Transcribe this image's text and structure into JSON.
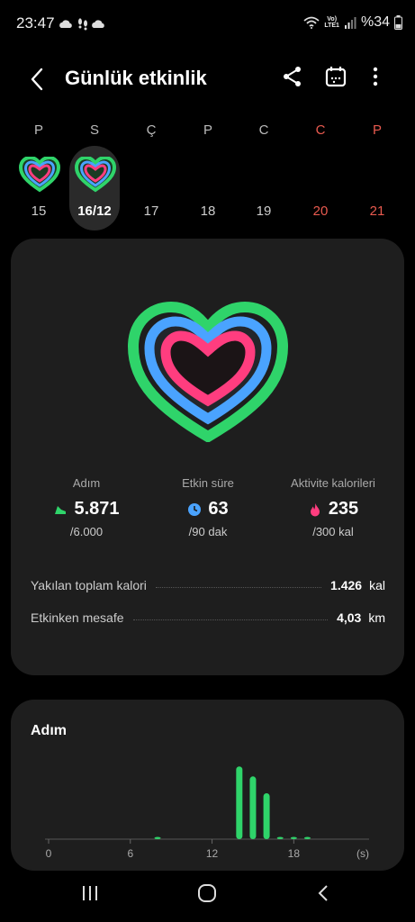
{
  "status_bar": {
    "time": "23:47",
    "left_icons": [
      "cloud-icon",
      "footsteps-icon",
      "cloud-icon"
    ],
    "right_icons": [
      "wifi-icon",
      "volte-icon",
      "signal-icon"
    ],
    "volte_text_1": "Vo)",
    "volte_text_2": "LTE1",
    "battery": "%34"
  },
  "app_bar": {
    "title": "Günlük etkinlik",
    "icons": [
      "back-icon",
      "share-icon",
      "calendar-icon",
      "more-icon"
    ]
  },
  "week": {
    "days": [
      {
        "letter": "P",
        "num": "15",
        "selected": false,
        "weekend": false,
        "has_ring": true
      },
      {
        "letter": "S",
        "num": "16/12",
        "selected": true,
        "weekend": false,
        "has_ring": true
      },
      {
        "letter": "Ç",
        "num": "17",
        "selected": false,
        "weekend": false,
        "has_ring": false
      },
      {
        "letter": "P",
        "num": "18",
        "selected": false,
        "weekend": false,
        "has_ring": false
      },
      {
        "letter": "C",
        "num": "19",
        "selected": false,
        "weekend": false,
        "has_ring": false
      },
      {
        "letter": "C",
        "num": "20",
        "selected": false,
        "weekend": true,
        "has_ring": false
      },
      {
        "letter": "P",
        "num": "21",
        "selected": false,
        "weekend": true,
        "has_ring": false
      }
    ],
    "weekend_color": "#e85a4f"
  },
  "summary": {
    "stats": [
      {
        "label": "Adım",
        "value": "5.871",
        "goal": "/6.000",
        "icon": "shoe-icon",
        "color": "#2fd46a",
        "progress": 0.98
      },
      {
        "label": "Etkin süre",
        "value": "63",
        "goal": "/90 dak",
        "icon": "clock-icon",
        "color": "#4aa3ff",
        "progress": 0.7
      },
      {
        "label": "Aktivite kalorileri",
        "value": "235",
        "goal": "/300 kal",
        "icon": "flame-icon",
        "color": "#ff3d7f",
        "progress": 0.78
      }
    ],
    "rows": [
      {
        "label": "Yakılan toplam kalori",
        "value": "1.426",
        "unit": "kal"
      },
      {
        "label": "Etkinken mesafe",
        "value": "4,03",
        "unit": "km"
      }
    ]
  },
  "steps_card": {
    "title": "Adım",
    "x_ticks": [
      "0",
      "6",
      "12",
      "18"
    ],
    "x_unit": "(s)"
  },
  "chart_data": {
    "type": "bar",
    "title": "Adım",
    "xlabel": "(s)",
    "ylabel": "",
    "x_ticks": [
      0,
      6,
      12,
      18
    ],
    "xlim": [
      0,
      23
    ],
    "ylim": [
      0,
      1000
    ],
    "color": "#2fd46a",
    "categories": [
      8,
      14,
      15,
      16,
      17,
      18,
      19
    ],
    "values": [
      30,
      950,
      820,
      600,
      30,
      30,
      30
    ]
  },
  "nav_bar": {
    "icons": [
      "recent-apps-icon",
      "home-icon",
      "back-nav-icon"
    ]
  }
}
